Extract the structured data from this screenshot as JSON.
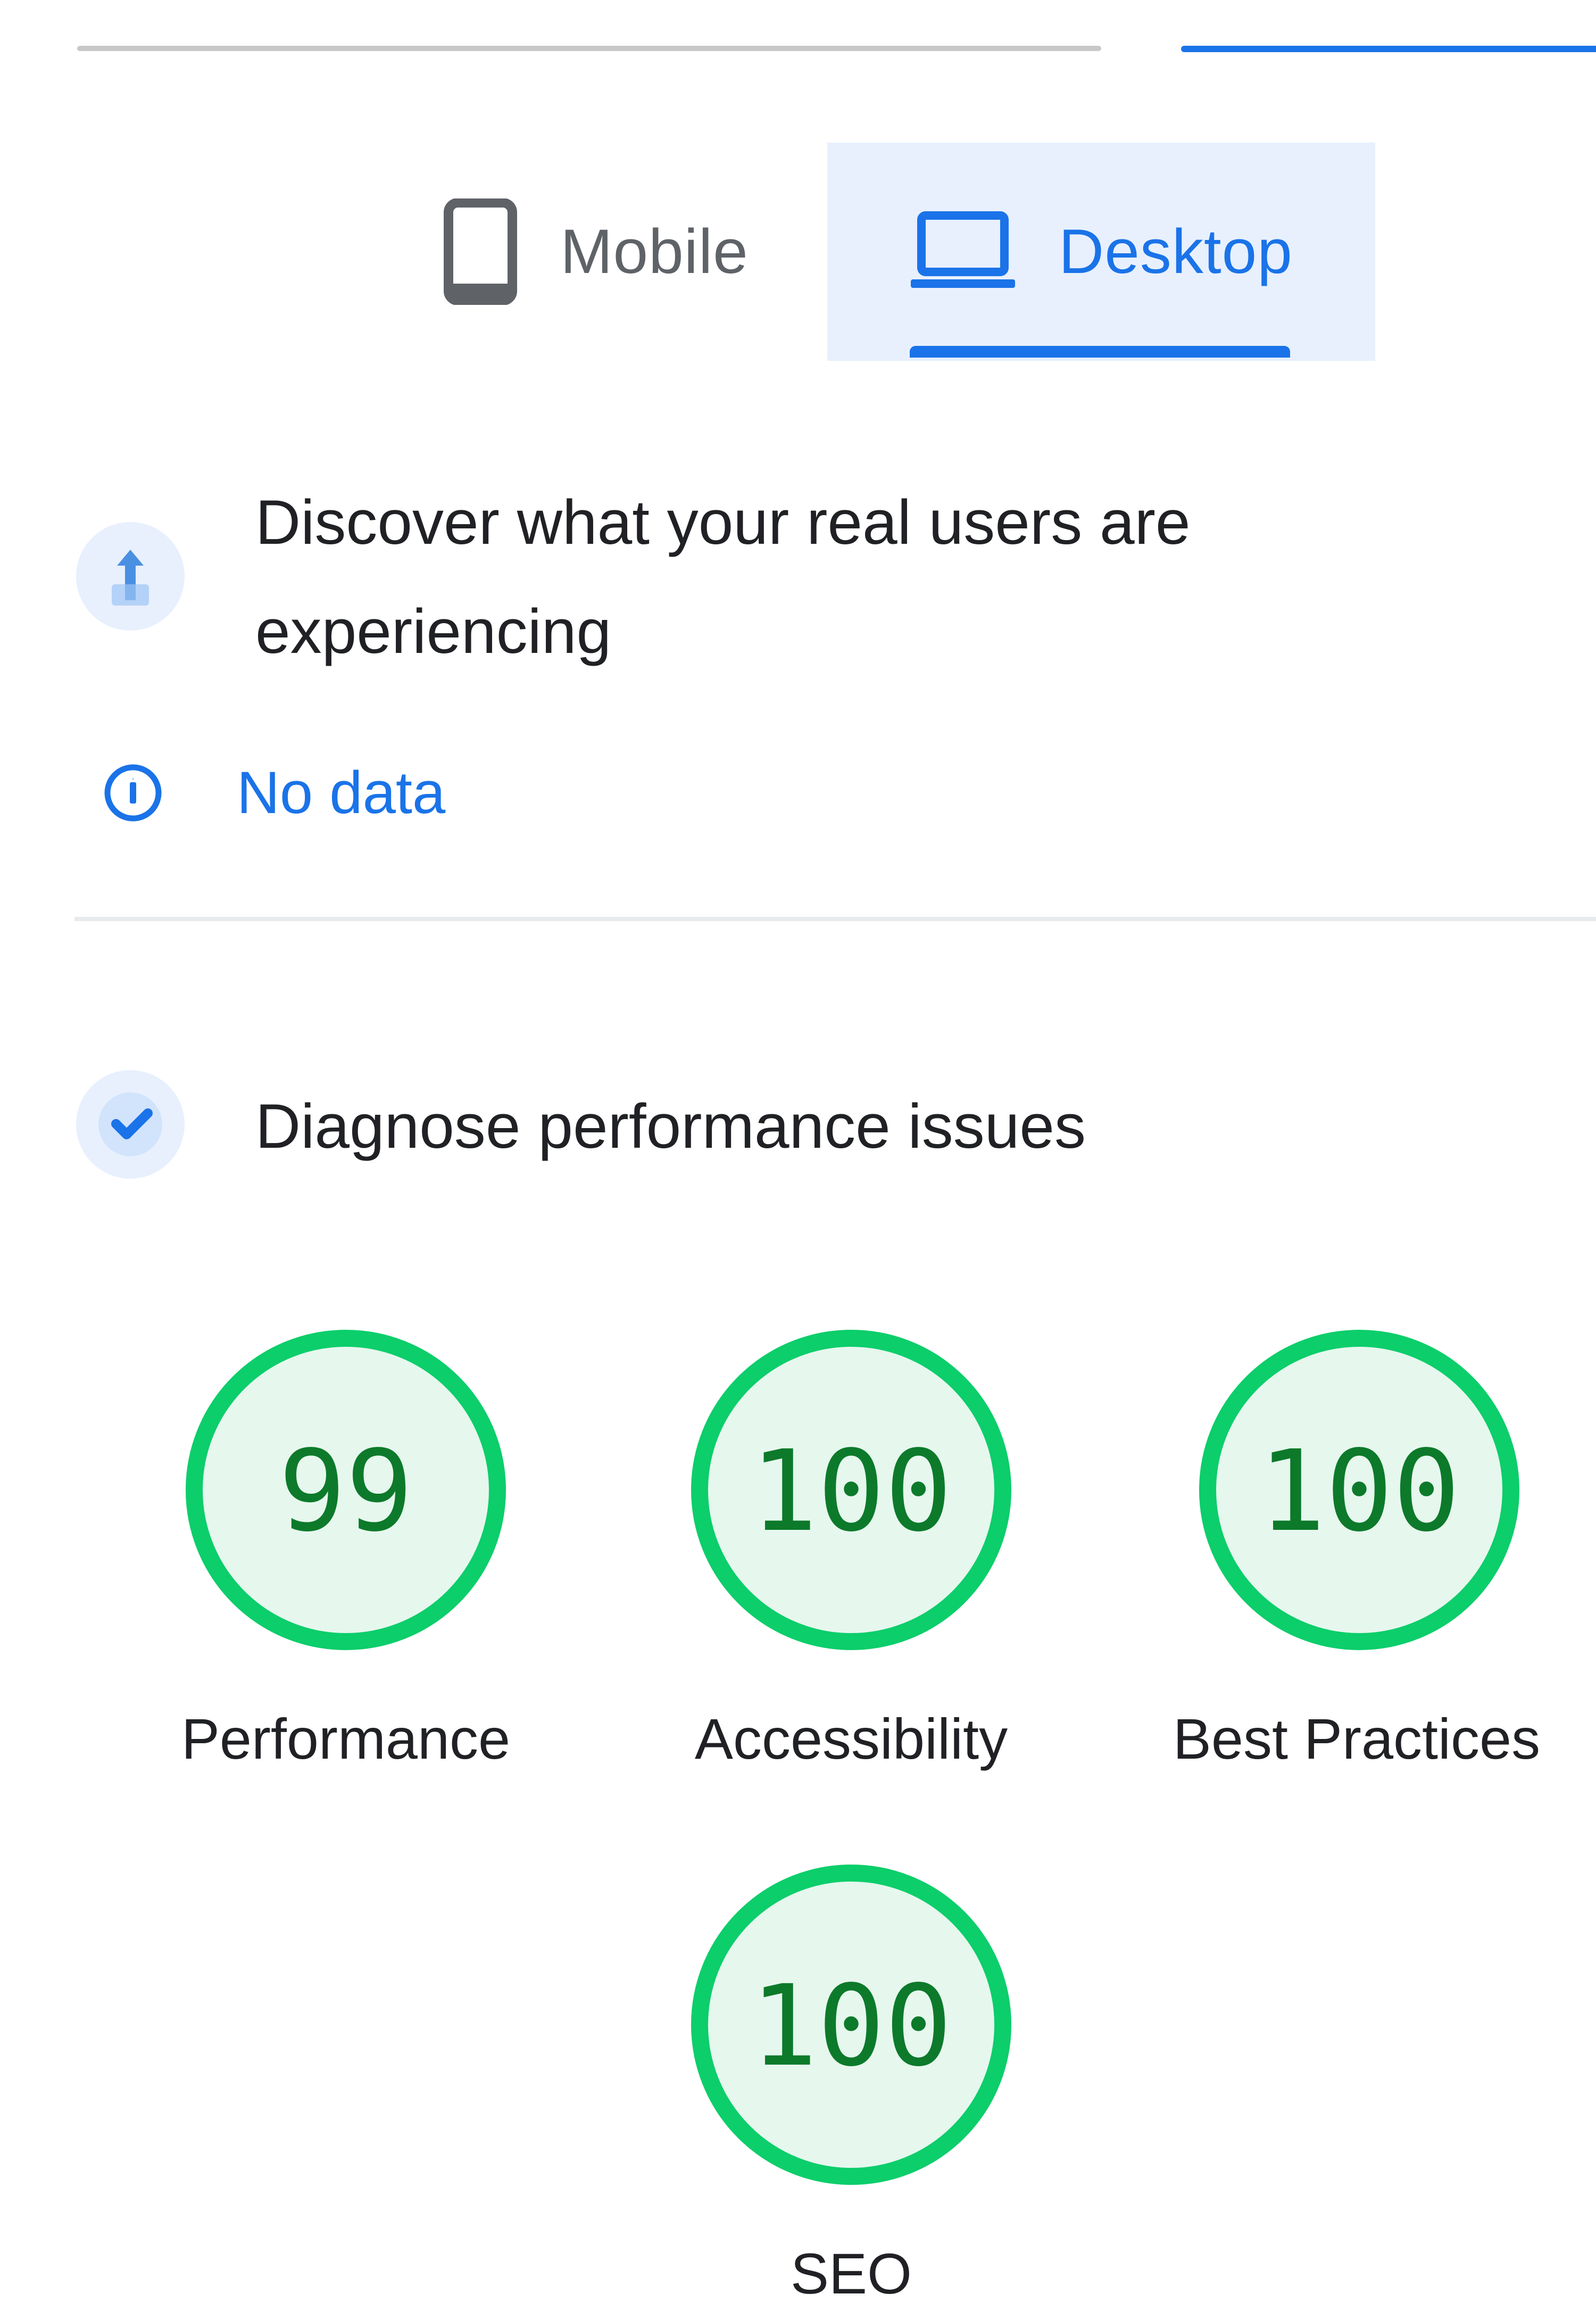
{
  "device_toggle": {
    "mobile_label": "Mobile",
    "desktop_label": "Desktop",
    "selected": "Desktop"
  },
  "field_data": {
    "title_line1": "Discover what your real users are",
    "title_line2": "experiencing",
    "status": "No data"
  },
  "lab_data": {
    "title": "Diagnose performance issues"
  },
  "scores": [
    {
      "label": "Performance",
      "value": "99"
    },
    {
      "label": "Accessibility",
      "value": "100"
    },
    {
      "label": "Best Practices",
      "value": "100"
    },
    {
      "label": "SEO",
      "value": "100"
    }
  ],
  "colors": {
    "accent": "#1a73e8",
    "pass_ring": "#0cce6b",
    "pass_fill": "#e6f7ee",
    "pass_text": "#0c7a2a"
  }
}
